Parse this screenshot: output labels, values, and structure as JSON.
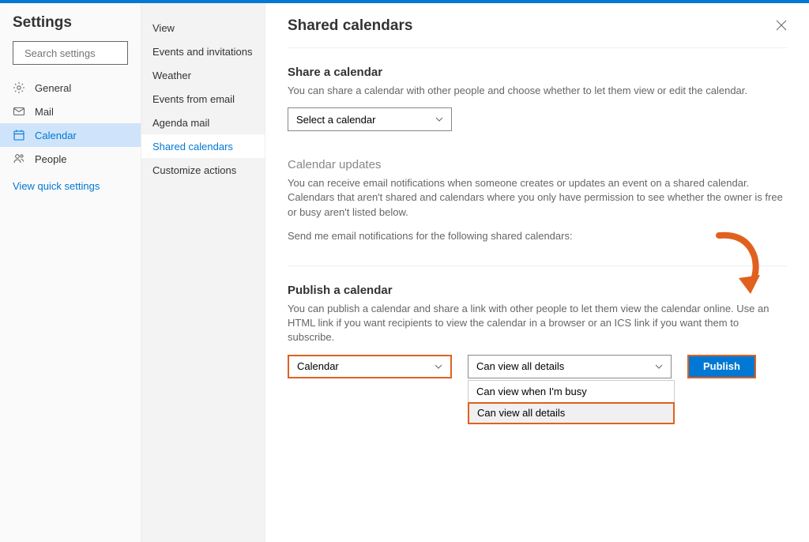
{
  "top": {
    "title": "Settings",
    "search_placeholder": "Search settings"
  },
  "nav": {
    "items": [
      {
        "label": "General"
      },
      {
        "label": "Mail"
      },
      {
        "label": "Calendar"
      },
      {
        "label": "People"
      }
    ],
    "quick": "View quick settings"
  },
  "subnav": {
    "items": [
      {
        "label": "View"
      },
      {
        "label": "Events and invitations"
      },
      {
        "label": "Weather"
      },
      {
        "label": "Events from email"
      },
      {
        "label": "Agenda mail"
      },
      {
        "label": "Shared calendars"
      },
      {
        "label": "Customize actions"
      }
    ]
  },
  "main": {
    "title": "Shared calendars",
    "share": {
      "title": "Share a calendar",
      "desc": "You can share a calendar with other people and choose whether to let them view or edit the calendar.",
      "select": "Select a calendar"
    },
    "updates": {
      "title": "Calendar updates",
      "desc": "You can receive email notifications when someone creates or updates an event on a shared calendar. Calendars that aren't shared and calendars where you only have permission to see whether the owner is free or busy aren't listed below.",
      "desc2": "Send me email notifications for the following shared calendars:"
    },
    "publish": {
      "title": "Publish a calendar",
      "desc": "You can publish a calendar and share a link with other people to let them view the calendar online. Use an HTML link if you want recipients to view the calendar in a browser or an ICS link if you want them to subscribe.",
      "calendar_select": "Calendar",
      "perm_select": "Can view all details",
      "perm_options": [
        "Can view when I'm busy",
        "Can view all details"
      ],
      "button": "Publish"
    }
  }
}
